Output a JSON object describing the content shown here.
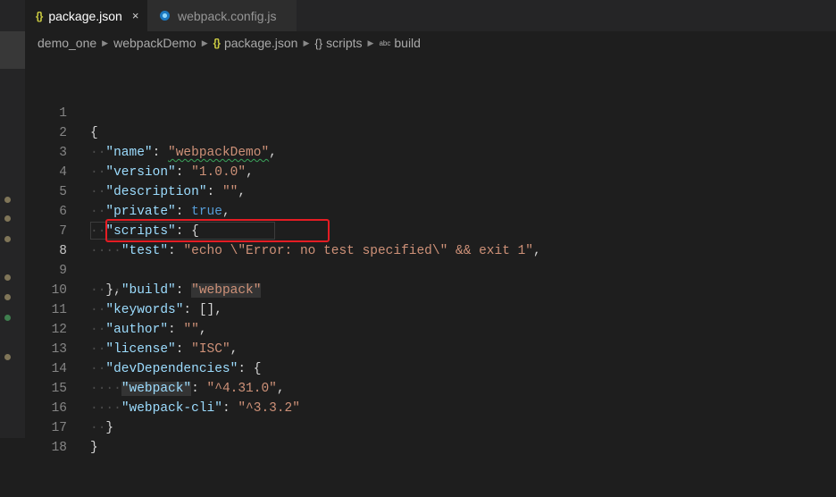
{
  "tabs": [
    {
      "icon": "{}",
      "label": "package.json",
      "close": "×",
      "active": true
    },
    {
      "label": "webpack.config.js",
      "active": false
    }
  ],
  "breadcrumb": {
    "items": [
      "demo_one",
      "webpackDemo",
      "package.json",
      "scripts",
      "build"
    ],
    "json_icon": "{}",
    "scripts_icon": "{}",
    "build_icon": "abc"
  },
  "editor": {
    "current_line": 8,
    "lines": [
      {
        "n": "1"
      },
      {
        "n": "2"
      },
      {
        "n": "3"
      },
      {
        "n": "4"
      },
      {
        "n": "5"
      },
      {
        "n": "6"
      },
      {
        "n": "7"
      },
      {
        "n": "8"
      },
      {
        "n": "9"
      },
      {
        "n": "10"
      },
      {
        "n": "11"
      },
      {
        "n": "12"
      },
      {
        "n": "13"
      },
      {
        "n": "14"
      },
      {
        "n": "15"
      },
      {
        "n": "16"
      },
      {
        "n": "17"
      },
      {
        "n": "18"
      }
    ],
    "code": {
      "l1": "{",
      "l2_key": "\"name\"",
      "l2_val": "\"webpackDemo\"",
      "l3_key": "\"version\"",
      "l3_val": "\"1.0.0\"",
      "l4_key": "\"description\"",
      "l4_val": "\"\"",
      "l5_key": "\"private\"",
      "l5_val": "true",
      "l6_key": "\"scripts\"",
      "l7_key": "\"test\"",
      "l7_val": "\"echo \\\"Error: no test specified\\\" && exit 1\"",
      "l8_key": "\"build\"",
      "l8_val": "\"webpack\"",
      "l9": "},",
      "l10_key": "\"keywords\"",
      "l10_val": "[]",
      "l11_key": "\"author\"",
      "l11_val": "\"\"",
      "l12_key": "\"license\"",
      "l12_val": "\"ISC\"",
      "l13_key": "\"devDependencies\"",
      "l14_key": "\"webpack\"",
      "l14_val": "\"^4.31.0\"",
      "l15_key": "\"webpack-cli\"",
      "l15_val": "\"^3.3.2\"",
      "l16": "}",
      "l17": "}",
      "l18": ""
    }
  },
  "colors": {
    "background": "#1e1e1e",
    "key": "#9cdcfe",
    "string": "#ce9178",
    "boolean": "#569cd6",
    "annotation_box": "#e51c23"
  }
}
